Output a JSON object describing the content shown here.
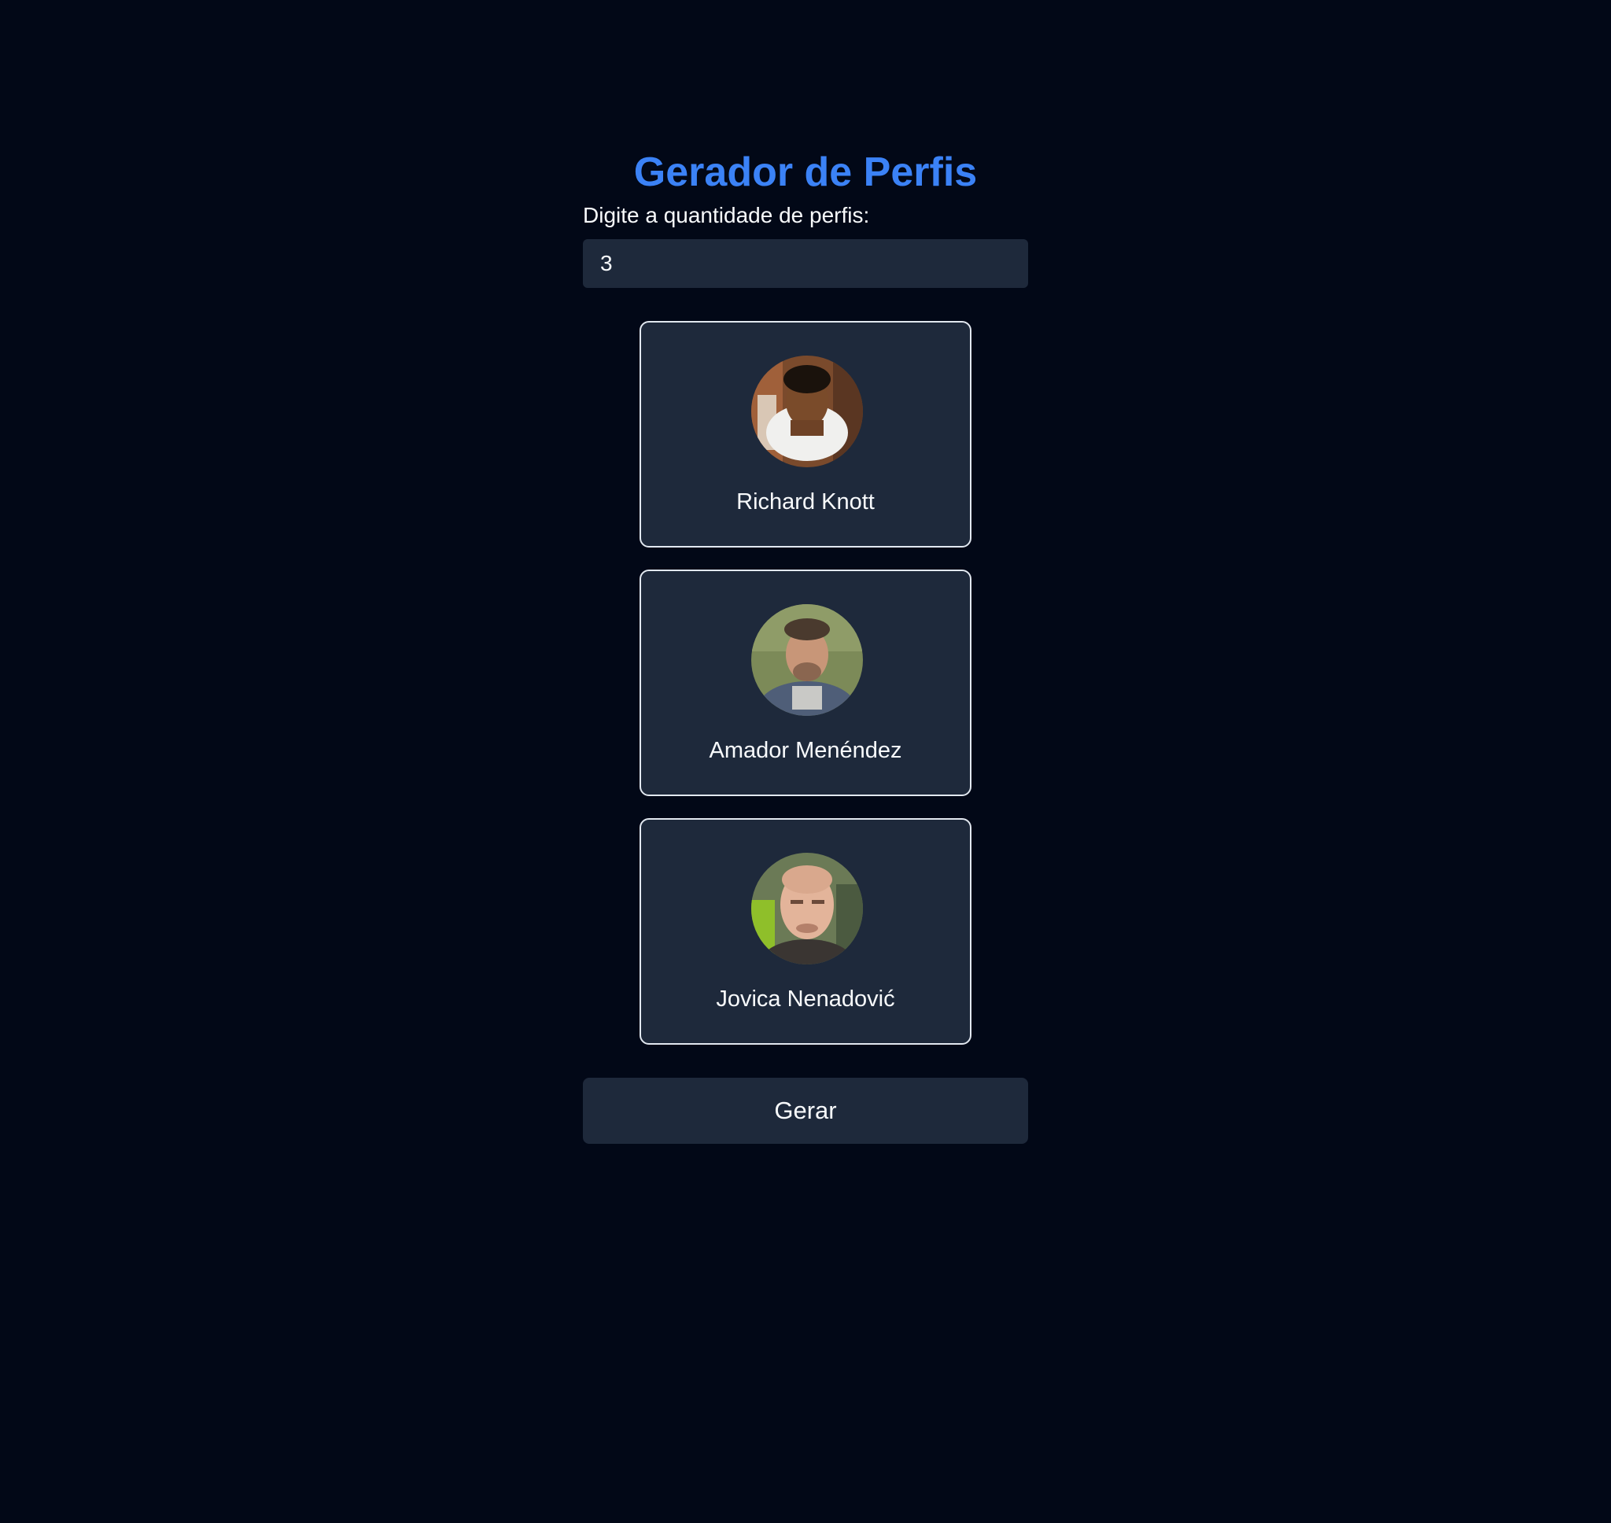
{
  "header": {
    "title": "Gerador de Perfis"
  },
  "form": {
    "quantity_label": "Digite a quantidade de perfis:",
    "quantity_value": "3"
  },
  "profiles": [
    {
      "name": "Richard Knott"
    },
    {
      "name": "Amador Menéndez"
    },
    {
      "name": "Jovica Nenadović"
    }
  ],
  "actions": {
    "generate_label": "Gerar"
  },
  "colors": {
    "background": "#020817",
    "accent": "#3b82f6",
    "card": "#1e293b",
    "card_border": "#e2e8f0",
    "text": "#f8fafc"
  }
}
